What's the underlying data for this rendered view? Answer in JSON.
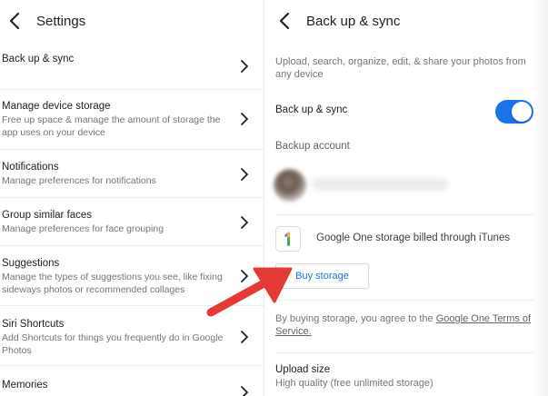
{
  "left": {
    "title": "Settings",
    "items": [
      {
        "title": "Back up & sync",
        "subtitle": ""
      },
      {
        "title": "Manage device storage",
        "subtitle": "Free up space & manage the amount of storage the app uses on your device"
      },
      {
        "title": "Notifications",
        "subtitle": "Manage preferences for notifications"
      },
      {
        "title": "Group similar faces",
        "subtitle": "Manage preferences for face grouping"
      },
      {
        "title": "Suggestions",
        "subtitle": "Manage the types of suggestions you see, like fixing sideways photos or recommended collages"
      },
      {
        "title": "Siri Shortcuts",
        "subtitle": "Add Shortcuts for things you frequently do in Google Photos"
      },
      {
        "title": "Memories",
        "subtitle": ""
      }
    ]
  },
  "right": {
    "title": "Back up & sync",
    "intro": "Upload, search, organize, edit, & share your photos from any device",
    "sync_label": "Back up & sync",
    "sync_enabled": true,
    "account_label": "Backup account",
    "google_one_text": "Google One storage billed through iTunes",
    "buy_button": "Buy storage",
    "terms_prefix": "By buying storage, you agree to the ",
    "terms_link": "Google One Terms of Service.",
    "upload_title": "Upload size",
    "upload_sub": "High quality (free unlimited storage)"
  },
  "colors": {
    "accent": "#1a73e8",
    "annotation": "#e53935"
  },
  "icons": {
    "back": "chevron-left-icon",
    "row": "chevron-right-icon",
    "google_one": "google-one-icon"
  }
}
